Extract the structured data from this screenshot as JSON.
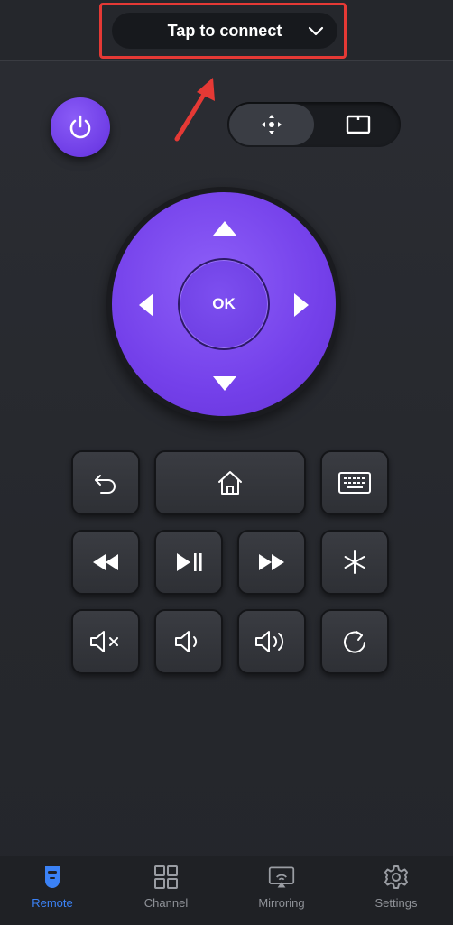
{
  "header": {
    "connect_label": "Tap to connect"
  },
  "remote": {
    "power": "power-icon",
    "modes": [
      "dpad-mode-icon",
      "touchpad-mode-icon"
    ],
    "ok_label": "OK"
  },
  "tabs": [
    {
      "label": "Remote",
      "icon": "remote-icon",
      "active": true
    },
    {
      "label": "Channel",
      "icon": "grid-icon",
      "active": false
    },
    {
      "label": "Mirroring",
      "icon": "cast-icon",
      "active": false
    },
    {
      "label": "Settings",
      "icon": "gear-icon",
      "active": false
    }
  ],
  "colors": {
    "accent": "#7440ea",
    "active_tab": "#3b82f6",
    "highlight": "#e53935"
  }
}
